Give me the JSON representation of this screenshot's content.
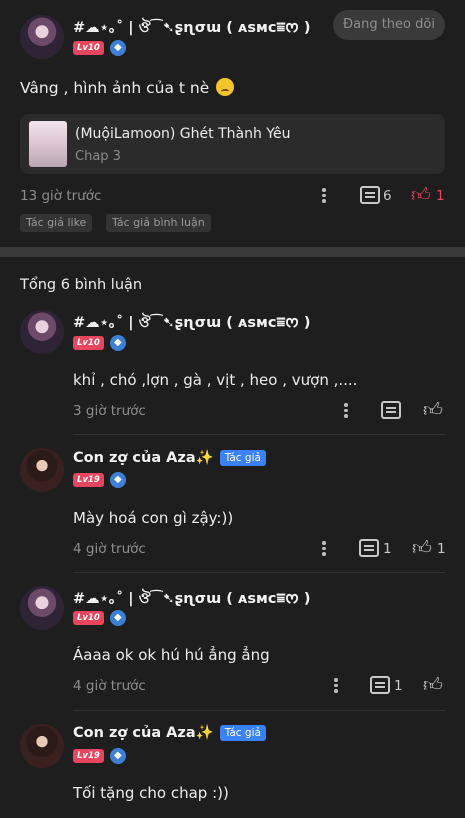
{
  "post": {
    "username": "#☁⋆｡˚ | ঔ⁀➷ʂɳσɯ ( ᴀsᴍᴄ⩸ᰔ )",
    "level": "Lv10",
    "follow_label": "Đang theo dõi",
    "text": "Vâng , hình ảnh của t nè",
    "chapter": {
      "title": "(MuộiLamoon) Ghét Thành Yêu",
      "subtitle": "Chap 3"
    },
    "time": "13 giờ trước",
    "comments_count": "6",
    "likes_count": "1",
    "tags": [
      "Tác giả like",
      "Tác giả bình luận"
    ]
  },
  "comments_section": {
    "total_label": "Tổng 6 bình luận",
    "comments": [
      {
        "username": "#☁⋆｡˚ | ঔ⁀➷ʂɳσɯ ( ᴀsᴍᴄ⩸ᰔ )",
        "level": "Lv10",
        "text": "khỉ , chó ,lợn , gà , vịt , heo , vượn ,....",
        "time": "3 giờ trước",
        "replies": "",
        "likes": ""
      },
      {
        "username": "Con zợ của Aza✨",
        "author_tag": "Tác giả",
        "level": "Lv19",
        "text": "Mày hoá con gì zậy:))",
        "time": "4 giờ trước",
        "replies": "1",
        "likes": "1"
      },
      {
        "username": "#☁⋆｡˚ | ঔ⁀➷ʂɳσɯ ( ᴀsᴍᴄ⩸ᰔ )",
        "level": "Lv10",
        "text": "Áaaa ok ok hú hú ẳng ẳng",
        "time": "4 giờ trước",
        "replies": "1",
        "likes": ""
      },
      {
        "username": "Con zợ của Aza✨",
        "author_tag": "Tác giả",
        "level": "Lv19",
        "text": "Tối tặng cho chap :))",
        "time": "",
        "replies": "",
        "likes": ""
      }
    ]
  },
  "icons": {
    "more": "more-vertical-icon",
    "comment": "comment-icon",
    "like": "thumbs-up-icon",
    "verify": "shield-badge-icon"
  },
  "colors": {
    "accent": "#e8455f",
    "author_tag": "#3b82f6",
    "background": "#1e1e1e"
  }
}
